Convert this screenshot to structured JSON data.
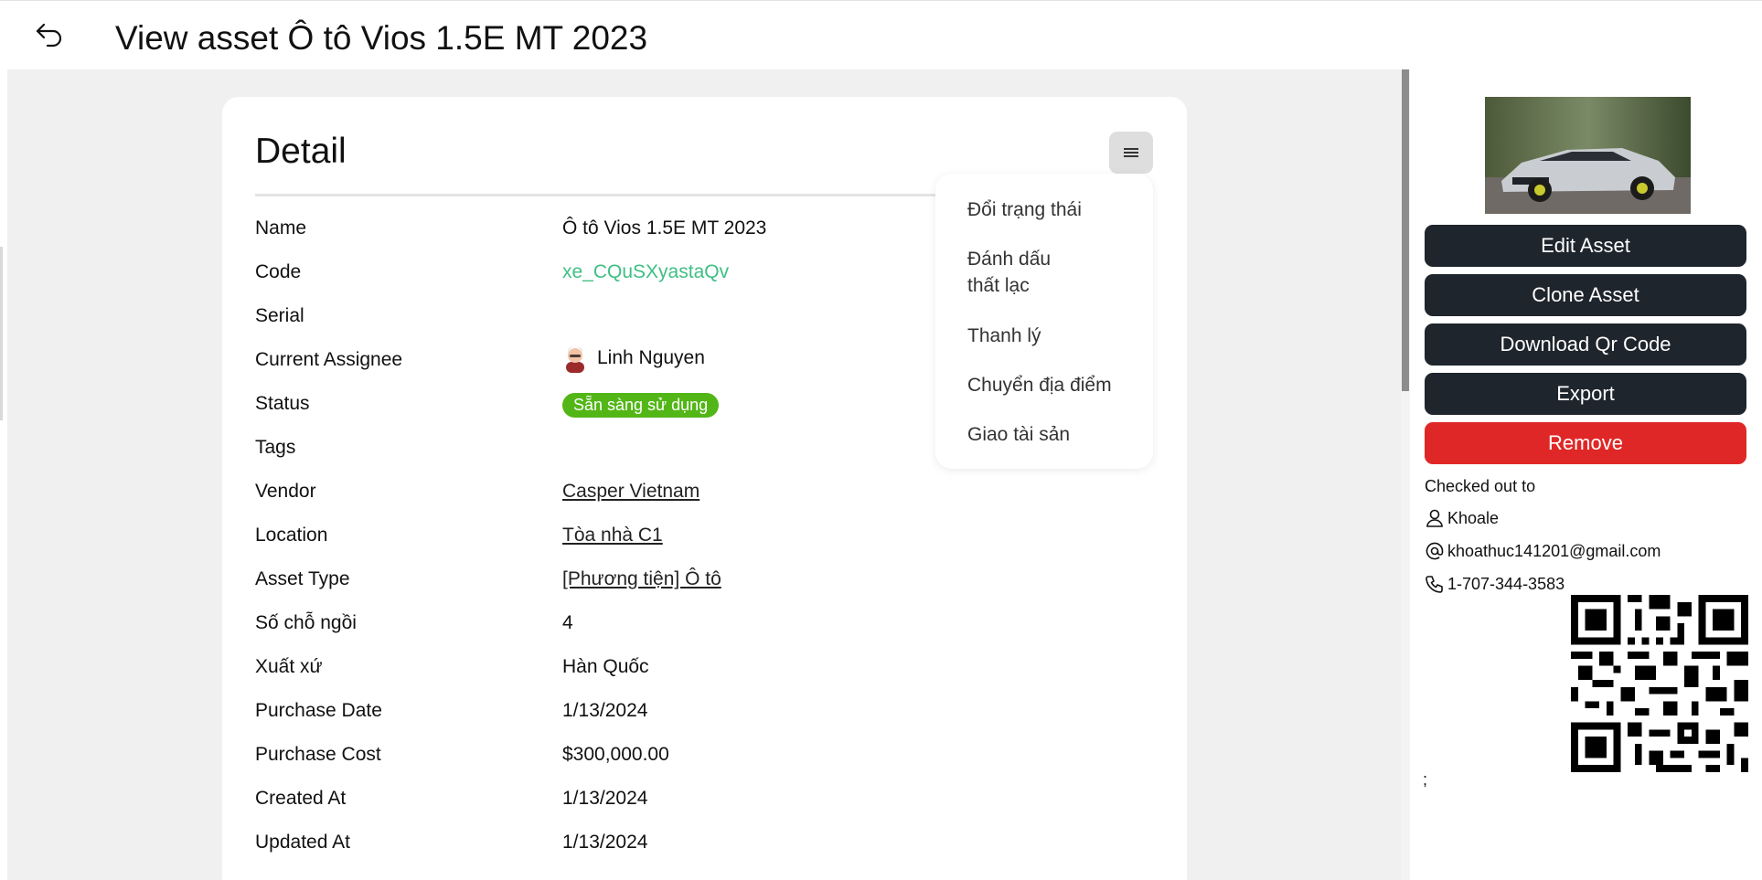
{
  "header": {
    "title": "View asset Ô tô Vios 1.5E MT 2023"
  },
  "card": {
    "title": "Detail"
  },
  "fields": [
    {
      "label": "Name",
      "value": "Ô tô Vios 1.5E MT 2023"
    },
    {
      "label": "Code",
      "value": "xe_CQuSXyastaQv"
    },
    {
      "label": "Serial",
      "value": ""
    },
    {
      "label": "Current Assignee",
      "value": "Linh Nguyen"
    },
    {
      "label": "Status",
      "value": "Sẵn sàng sử dụng"
    },
    {
      "label": "Tags",
      "value": ""
    },
    {
      "label": "Vendor",
      "value": "Casper Vietnam"
    },
    {
      "label": "Location",
      "value": "Tòa nhà C1"
    },
    {
      "label": "Asset Type",
      "value": "[Phương tiện] Ô tô"
    },
    {
      "label": "Số chỗ ngồi",
      "value": "4"
    },
    {
      "label": "Xuất xứ",
      "value": "Hàn Quốc"
    },
    {
      "label": "Purchase Date",
      "value": "1/13/2024"
    },
    {
      "label": "Purchase Cost",
      "value": "$300,000.00"
    },
    {
      "label": "Created At",
      "value": "1/13/2024"
    },
    {
      "label": "Updated At",
      "value": "1/13/2024"
    }
  ],
  "menu": {
    "items": [
      {
        "label": "Đổi trạng thái"
      },
      {
        "label": "Đánh dấu thất lạc"
      },
      {
        "label": "Thanh lý"
      },
      {
        "label": "Chuyển địa điểm"
      },
      {
        "label": "Giao tài sản"
      }
    ]
  },
  "sidebar": {
    "buttons": {
      "edit": "Edit Asset",
      "clone": "Clone Asset",
      "download_qr": "Download Qr Code",
      "export": "Export",
      "remove": "Remove"
    },
    "checked_out": {
      "title": "Checked out to",
      "user": "Khoale",
      "email": "khoathuc141201@gmail.com",
      "phone": "1-707-344-3583"
    },
    "trailing_text": ";"
  },
  "colors": {
    "primary_button": "#1f252c",
    "danger_button": "#e02727",
    "status_badge": "#52b617",
    "code_text": "#3fbf84"
  }
}
